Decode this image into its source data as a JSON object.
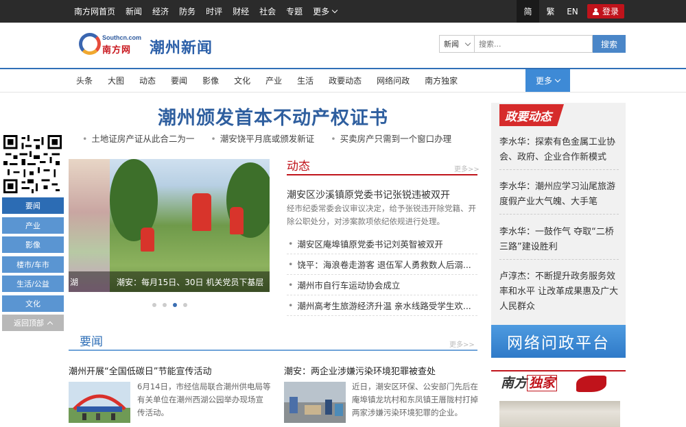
{
  "topbar": {
    "nav": [
      "南方网首页",
      "新闻",
      "经济",
      "防务",
      "时评",
      "财经",
      "社会",
      "专题"
    ],
    "more": "更多",
    "lang": [
      "简",
      "繁",
      "EN"
    ],
    "login": "登录"
  },
  "header": {
    "logo_en": "Southcn.com",
    "logo_cn": "南方网",
    "title": "潮州新闻",
    "search_select": "新闻",
    "search_placeholder": "搜索...",
    "search_button": "搜索"
  },
  "nav": {
    "items": [
      "头条",
      "大图",
      "动态",
      "要闻",
      "影像",
      "文化",
      "产业",
      "生活",
      "政要动态",
      "网络问政",
      "南方独家"
    ],
    "more": "更多"
  },
  "headline": {
    "title": "潮州颁发首本不动产权证书",
    "links": [
      "土地证房产证从此合二为一",
      "潮安饶平月底或颁发新证",
      "买卖房产只需到一个窗口办理"
    ]
  },
  "side_menu": {
    "items": [
      "要闻",
      "产业",
      "影像",
      "楼市/车市",
      "生活/公益",
      "文化"
    ],
    "back_top": "返回顶部"
  },
  "slider": {
    "caption_left": "湖",
    "caption": "潮安：每月15日、30日 机关党员下基层",
    "current_dot": 3,
    "dot_count": 4
  },
  "dongtai": {
    "title": "动态",
    "more": "更多>>",
    "main_title": "潮安区沙溪镇原党委书记张锐违被双开",
    "main_desc": "经市纪委常委会议审议决定，给予张锐违开除党籍、开除公职处分，对涉案款项依纪依规进行处理。",
    "items": [
      "潮安区庵埠镇原党委书记刘英智被双开",
      "饶平：海浪卷走游客 退伍军人勇救数人后溺...",
      "潮州市自行车运动协会成立",
      "潮州高考生旅游经济升温 亲水线路受学生欢..."
    ]
  },
  "yaowen": {
    "title": "要闻",
    "more": "更多>>",
    "articles": [
      {
        "title": "潮州开展“全国低碳日”节能宣传活动",
        "desc": "6月14日，市经信局联合潮州供电局等有关单位在潮州西湖公园举办现场宣传活动。"
      },
      {
        "title": "潮安：两企业涉嫌污染环境犯罪被查处",
        "desc": "近日，潮安区环保、公安部门先后在庵埠镇龙坑村和东凤镇王厝陇村打掉两家涉嫌污染环境犯罪的企业。"
      }
    ]
  },
  "right": {
    "zhengyao_title": "政要动态",
    "zhengyao_items": [
      "李水华：探索有色金属工业协会、政府、企业合作新模式",
      "李水华：潮州应学习汕尾旅游度假产业大气魄、大手笔",
      "李水华：一鼓作气 夺取“二桥三路”建设胜利",
      "卢淳杰：不断提升政务服务效率和水平 让改革成果惠及广大人民群众"
    ],
    "wlwz_banner": "网络问政平台",
    "dujia_prefix": "南方",
    "dujia_highlight": "独家"
  },
  "colors": {
    "accent_blue": "#2f6fb7",
    "accent_red": "#c0131b",
    "topbar_bg": "#2b2b2b"
  }
}
